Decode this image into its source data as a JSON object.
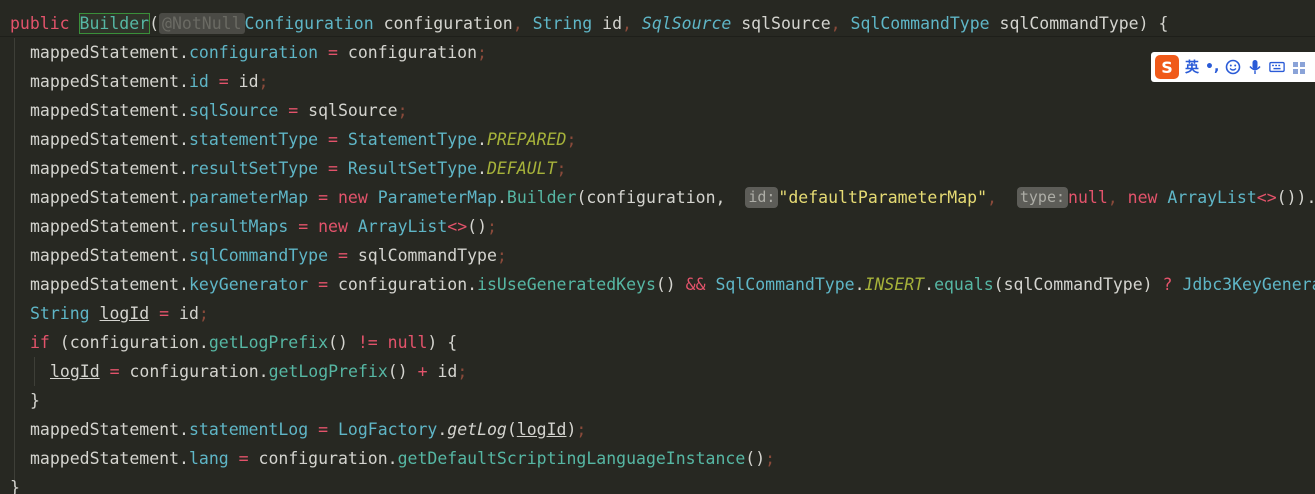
{
  "code": {
    "l1": {
      "kw": "public",
      "cls": "Builder",
      "paren_open": "(",
      "ann": "@NotNull",
      "p1_type": "Configuration",
      "p1_name": " configuration",
      "comma1": ",",
      "p2_type": "String",
      "p2_name": " id",
      "comma2": ",",
      "p3_type": "SqlSource",
      "p3_name": " sqlSource",
      "comma3": ",",
      "p4_type": "SqlCommandType",
      "p4_name": " sqlCommandType",
      "tail": ") {"
    },
    "l2": {
      "obj": "mappedStatement",
      "fld": "configuration",
      "eq": " = ",
      "val": "configuration",
      "semi": ";"
    },
    "l3": {
      "obj": "mappedStatement",
      "fld": "id",
      "eq": " = ",
      "val": "id",
      "semi": ";"
    },
    "l4": {
      "obj": "mappedStatement",
      "fld": "sqlSource",
      "eq": " = ",
      "val": "sqlSource",
      "semi": ";"
    },
    "l5": {
      "obj": "mappedStatement",
      "fld": "statementType",
      "eq": " = ",
      "typ": "StatementType",
      "con": "PREPARED",
      "semi": ";"
    },
    "l6": {
      "obj": "mappedStatement",
      "fld": "resultSetType",
      "eq": " = ",
      "typ": "ResultSetType",
      "con": "DEFAULT",
      "semi": ";"
    },
    "l7": {
      "obj": "mappedStatement",
      "fld": "parameterMap",
      "eq": " = ",
      "kw_new": "new",
      "typ1": "ParameterMap",
      "typ2": "Builder",
      "open": "(configuration,",
      "hint1": "id:",
      "str": "\"defaultParameterMap\"",
      "comma": ",",
      "hint2": "type:",
      "nul": "null",
      "comma2": ",",
      "kw_new2": "new",
      "typ3": "ArrayList",
      "diamond": "<>",
      "end": "()).b"
    },
    "l8": {
      "obj": "mappedStatement",
      "fld": "resultMaps",
      "eq": " = ",
      "kw_new": "new",
      "typ": "ArrayList",
      "diamond": "<>",
      "end": "()",
      "semi": ";"
    },
    "l9": {
      "obj": "mappedStatement",
      "fld": "sqlCommandType",
      "eq": " = ",
      "val": "sqlCommandType",
      "semi": ";"
    },
    "l10": {
      "obj": "mappedStatement",
      "fld": "keyGenerator",
      "eq": " = ",
      "val": "configuration",
      "meth": "isUseGeneratedKeys",
      "paren": "()",
      "and": " && ",
      "typ": "SqlCommandType",
      "con": "INSERT",
      "meth2": "equals",
      "arg": "(sqlCommandType)",
      "q": " ? ",
      "typ2": "Jdbc3KeyGenera"
    },
    "l11": {
      "typ": "String",
      "var": "logId",
      "eq": " = ",
      "val": "id",
      "semi": ";"
    },
    "l12": {
      "kw": "if",
      "open": " (configuration",
      "meth": "getLogPrefix",
      "paren": "()",
      "neq": " != ",
      "nul": "null",
      "close": ") {"
    },
    "l13": {
      "var": "logId",
      "eq": " = ",
      "val": "configuration",
      "meth": "getLogPrefix",
      "paren": "()",
      "plus": " + ",
      "val2": "id",
      "semi": ";"
    },
    "l14": {
      "brace": "}"
    },
    "l15": {
      "obj": "mappedStatement",
      "fld": "statementLog",
      "eq": " = ",
      "typ": "LogFactory",
      "meth": "getLog",
      "open": "(",
      "var": "logId",
      "close": ")",
      "semi": ";"
    },
    "l16": {
      "obj": "mappedStatement",
      "fld": "lang",
      "eq": " = ",
      "val": "configuration",
      "meth": "getDefaultScriptingLanguageInstance",
      "paren": "()",
      "semi": ";"
    },
    "l17": {
      "brace": "}"
    }
  },
  "ime": {
    "logo": "S",
    "lang": "英",
    "punct": "•,",
    "icons": [
      "emoji-icon",
      "mic-icon",
      "keyboard-icon",
      "skin-icon"
    ]
  }
}
